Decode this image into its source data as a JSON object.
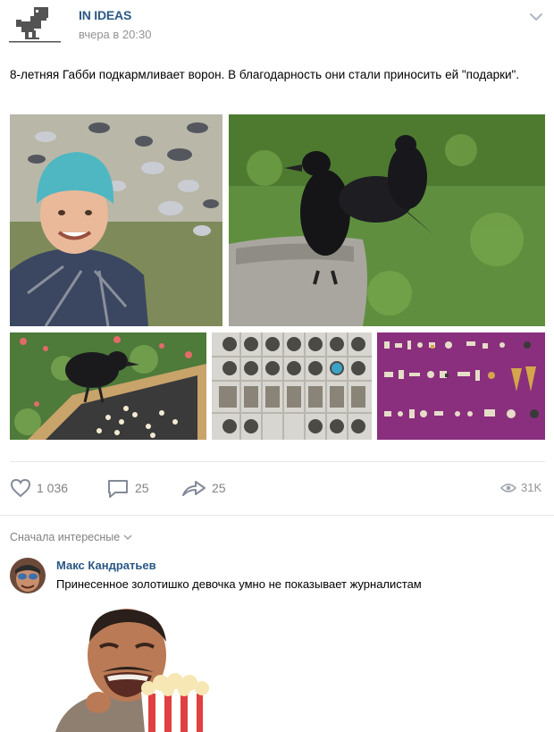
{
  "post": {
    "group_name": "IN IDEAS",
    "time": "вчера в 20:30",
    "text": "8-летняя Габби подкармливает ворон. В благодарность они стали приносить ей \"подарки\"."
  },
  "actions": {
    "likes": "1 036",
    "comments": "25",
    "shares": "25",
    "views": "31K"
  },
  "comments_section": {
    "sort_label": "Сначала интересные",
    "comment": {
      "author": "Макс Кандратьев",
      "text": "Принесенное золотишко девочка умно не показывает журналистам"
    }
  },
  "colors": {
    "link": "#2a5885",
    "muted": "#828282",
    "divider": "#e7e8ec"
  },
  "icons": [
    "dinosaur-avatar-icon",
    "chevron-down-icon",
    "heart-icon",
    "comment-icon",
    "share-arrow-icon",
    "eye-icon"
  ]
}
